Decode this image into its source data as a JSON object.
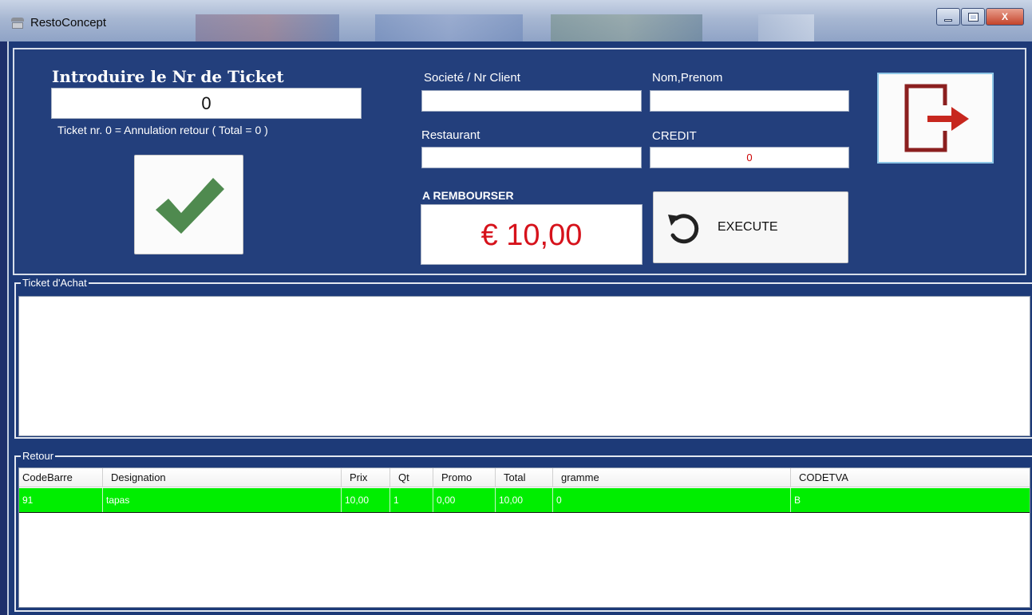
{
  "window": {
    "title": "RestoConcept",
    "minimize_label": "",
    "maximize_label": "",
    "close_label": "X"
  },
  "ticket": {
    "heading": "Introduire le Nr de Ticket",
    "value": "0",
    "hint": "Ticket nr. 0 = Annulation retour ( Total = 0 )"
  },
  "client": {
    "societe_label": "Societé / Nr Client",
    "societe_value": "",
    "nom_label": "Nom,Prenom",
    "nom_value": "",
    "restaurant_label": "Restaurant",
    "restaurant_value": "",
    "credit_label": "CREDIT",
    "credit_value": "0"
  },
  "refund": {
    "label": "A REMBOURSER",
    "amount": "€ 10,00"
  },
  "actions": {
    "execute_label": "EXECUTE"
  },
  "sections": {
    "ticket_achat": "Ticket d'Achat",
    "retour": "Retour"
  },
  "retour_table": {
    "columns": [
      "CodeBarre",
      "Designation",
      "Prix",
      "Qt",
      "Promo",
      "Total",
      "gramme",
      "CODETVA"
    ],
    "rows": [
      [
        "91",
        "tapas",
        "10,00",
        "1",
        "0,00",
        "10,00",
        "0",
        "B"
      ]
    ]
  },
  "colors": {
    "panel": "#233f7c",
    "refund_text": "#d6121b",
    "credit_text": "#cc0000",
    "selected_row": "#00ee00",
    "check": "#4f8a4f",
    "exit_icon": "#8b1f1f"
  },
  "icons": {
    "confirm": "checkmark-icon",
    "execute": "undo-icon",
    "exit": "exit-door-icon",
    "app": "cash-register-icon"
  }
}
